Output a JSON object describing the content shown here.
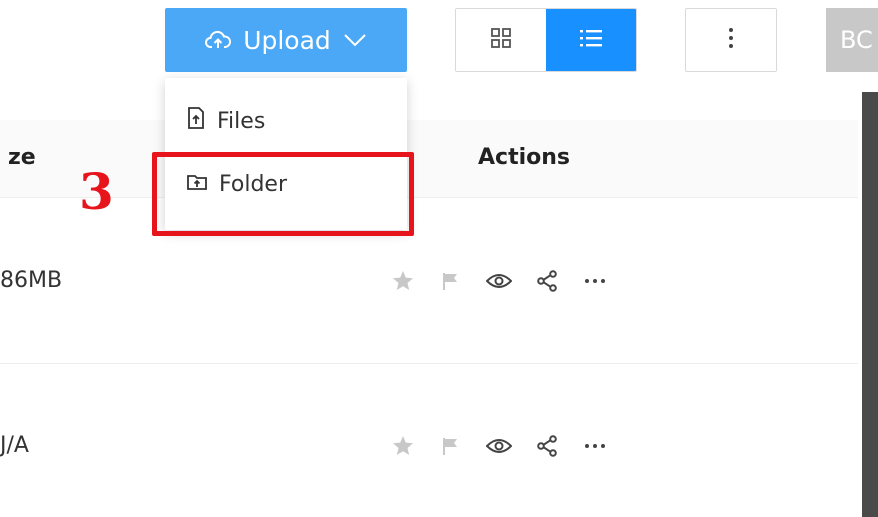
{
  "toolbar": {
    "upload_label": "Upload",
    "upload_icon": "cloud-upload-icon",
    "dropdown_icon": "chevron-down-icon",
    "views": [
      {
        "icon": "grid-view-icon",
        "active": false
      },
      {
        "icon": "list-view-icon",
        "active": true
      }
    ],
    "more_icon": "vertical-ellipsis-icon",
    "avatar_initials": "BC"
  },
  "upload_menu": {
    "items": [
      {
        "label": "Files",
        "icon": "file-upload-icon"
      },
      {
        "label": "Folder",
        "icon": "folder-upload-icon"
      }
    ]
  },
  "annotation": {
    "step": "3",
    "color": "#e8141c"
  },
  "table": {
    "columns": [
      "ze",
      "Actions"
    ],
    "rows": [
      {
        "size": "86MB"
      },
      {
        "size": "J/A"
      }
    ],
    "action_icons": [
      "star-icon",
      "flag-icon",
      "eye-icon",
      "share-icon",
      "more-horizontal-icon"
    ]
  },
  "colors": {
    "primary": "#1890ff",
    "upload_bg": "#4aa8f6",
    "icon_gray": "#c8c8c8"
  }
}
